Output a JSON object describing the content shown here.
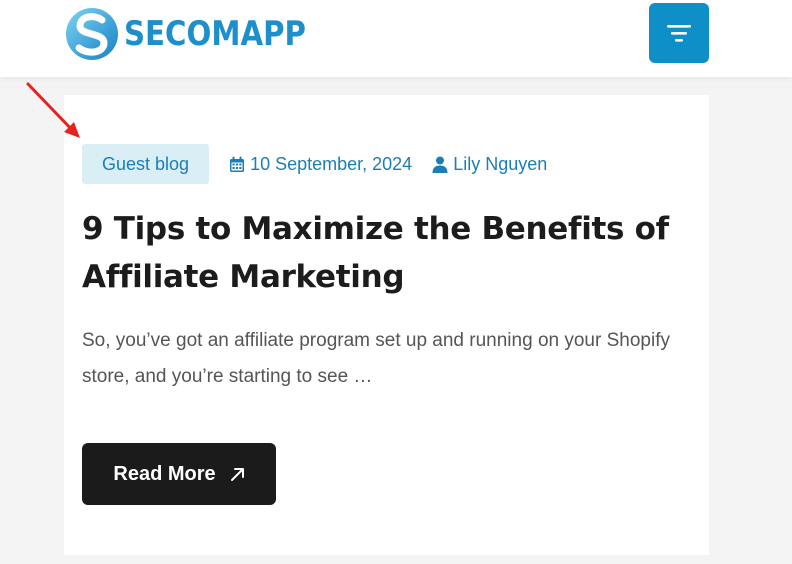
{
  "header": {
    "logo_text": "SECOMAPP",
    "brand_color": "#1e8fca",
    "menu_icon": "filter-menu-icon",
    "menu_color": "#0f8fc7"
  },
  "post": {
    "category": "Guest blog",
    "date": "10 September, 2024",
    "author": "Lily Nguyen",
    "date_icon": "calendar-icon",
    "author_icon": "user-icon",
    "title": "9 Tips to Maximize the Benefits of Affiliate Marketing",
    "excerpt": "So, you’ve got an affiliate program set up and running on your Shopify store, and you’re starting to see …",
    "read_more_label": "Read More",
    "read_more_icon": "arrow-up-right-icon"
  },
  "annotation": {
    "icon": "red-arrow-annotation",
    "color": "#e8231f"
  }
}
